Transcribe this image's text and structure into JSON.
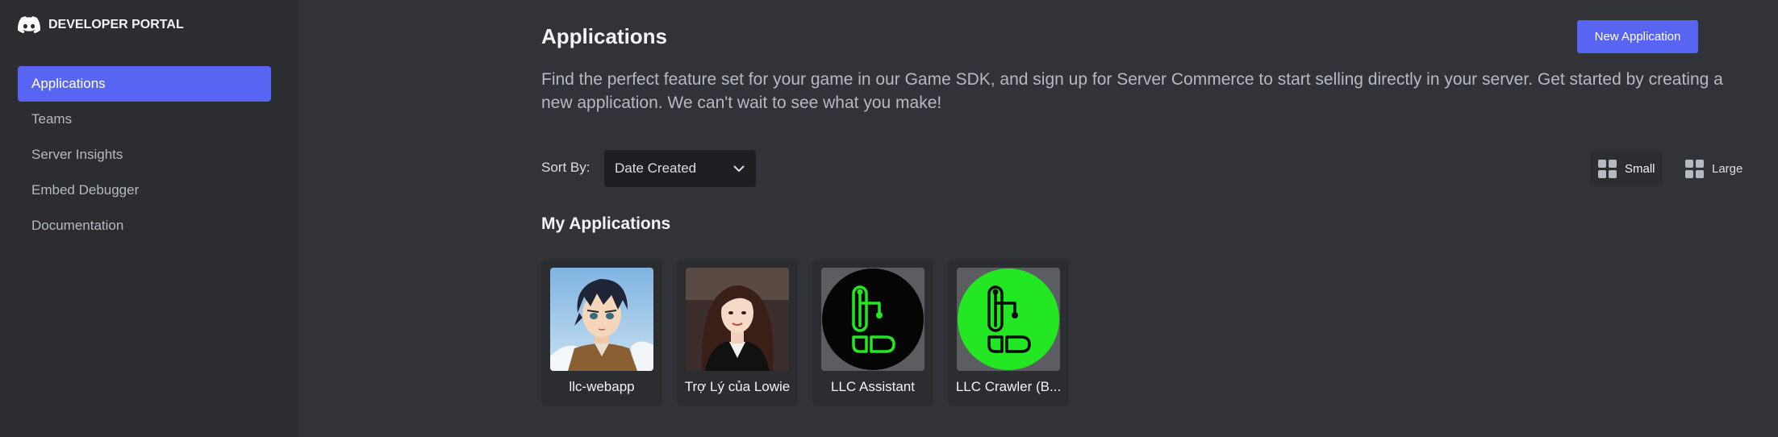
{
  "brand": {
    "name": "DEVELOPER PORTAL",
    "logo_icon": "discord-logo-icon"
  },
  "sidebar": {
    "items": [
      {
        "label": "Applications",
        "active": true
      },
      {
        "label": "Teams",
        "active": false
      },
      {
        "label": "Server Insights",
        "active": false
      },
      {
        "label": "Embed Debugger",
        "active": false
      },
      {
        "label": "Documentation",
        "active": false
      }
    ]
  },
  "header": {
    "title": "Applications",
    "new_button_label": "New Application",
    "description": "Find the perfect feature set for your game in our Game SDK, and sign up for Server Commerce to start selling directly in your server. Get started by creating a new application. We can't wait to see what you make!"
  },
  "sort": {
    "label": "Sort By:",
    "selected": "Date Created",
    "icon": "chevron-down-icon"
  },
  "view": {
    "small_label": "Small",
    "large_label": "Large",
    "selected": "Small"
  },
  "section_title": "My Applications",
  "apps": [
    {
      "name": "llc-webapp",
      "icon": "anime-avatar-icon"
    },
    {
      "name": "Trợ Lý của Lowie",
      "icon": "portrait-photo-icon"
    },
    {
      "name": "LLC Assistant",
      "icon": "llc-logo-black-icon"
    },
    {
      "name": "LLC Crawler (B...",
      "icon": "llc-logo-green-icon"
    }
  ],
  "colors": {
    "accent": "#5865f2",
    "background": "#313338",
    "sidebar": "#2b2d31",
    "llc_green": "#22e722"
  }
}
